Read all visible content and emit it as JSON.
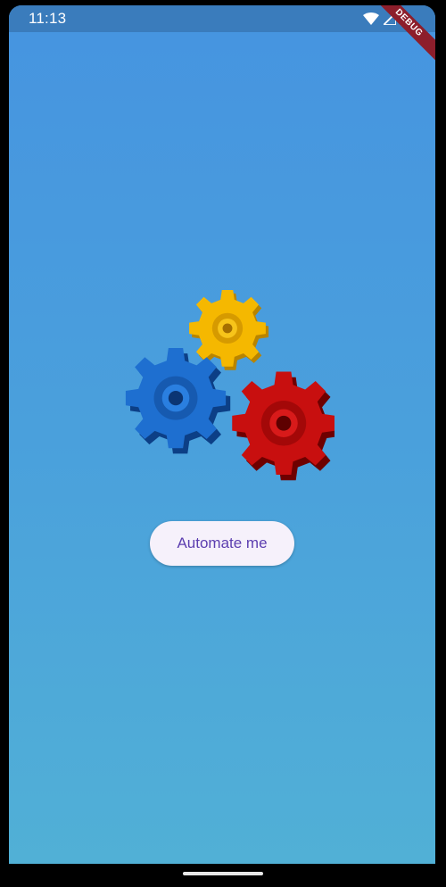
{
  "status_bar": {
    "time": "11:13",
    "icons": [
      "wifi-icon",
      "signal-icon",
      "battery-icon"
    ]
  },
  "debug_banner": {
    "label": "DEBUG"
  },
  "hero": {
    "icon": "gears-icon",
    "gear_colors": {
      "yellow": "#f5b800",
      "blue": "#1e6fd0",
      "red": "#c80f0f"
    }
  },
  "main": {
    "button_label": "Automate me"
  },
  "colors": {
    "background_top": "#4694e0",
    "background_bottom": "#51b0d6",
    "button_bg": "#f6f1fb",
    "button_text": "#5d3fb0"
  }
}
